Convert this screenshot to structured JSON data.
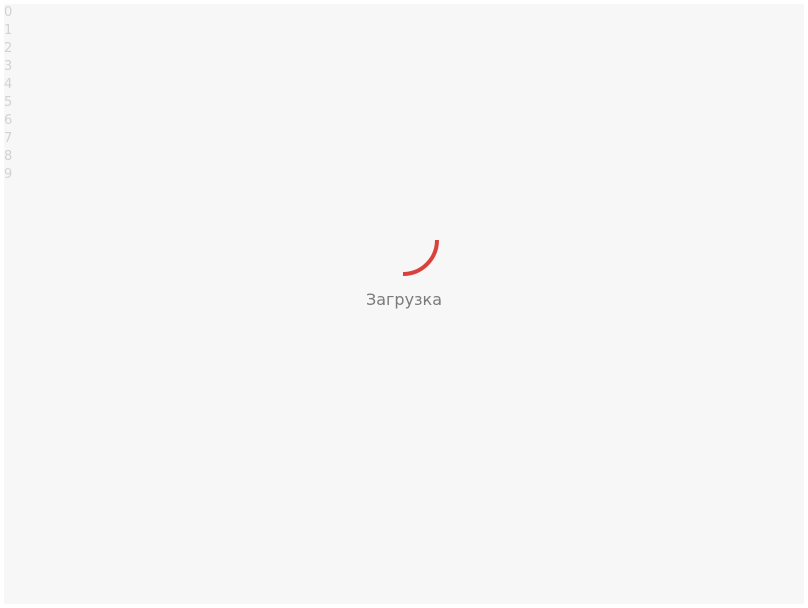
{
  "debug_lines": [
    "0",
    "1",
    "2",
    "3",
    "4",
    "5",
    "6",
    "7",
    "8",
    "9"
  ],
  "loader": {
    "label": "Загрузка",
    "spinner_icon": "spinner-arc-icon",
    "accent_color": "#d9423c"
  },
  "colors": {
    "background": "#f7f7f7",
    "text_muted": "#7a7a7a",
    "debug_text": "#d2d2d2"
  }
}
